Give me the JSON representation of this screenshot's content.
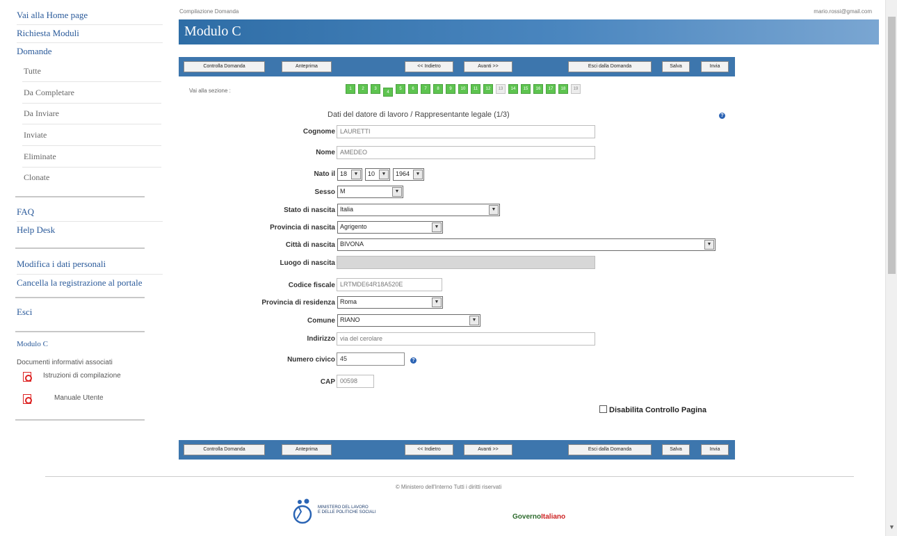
{
  "sidebar": {
    "home": "Vai alla Home page",
    "richiesta": "Richiesta Moduli",
    "domande": "Domande",
    "sub": [
      "Tutte",
      "Da Completare",
      "Da Inviare",
      "Inviate",
      "Eliminate",
      "Clonate"
    ],
    "faq": "FAQ",
    "help": "Help Desk",
    "modifica": "Modifica i dati personali",
    "cancella": "Cancella la registrazione al portale",
    "esci": "Esci",
    "modulo": "Modulo C",
    "docs_title": "Documenti informativi associati",
    "doc1": "Istruzioni di compilazione",
    "doc2": "Manuale Utente"
  },
  "header": {
    "breadcrumb": "Compilazione Domanda",
    "email": "mario.rossi@gmail.com",
    "title": "Modulo C"
  },
  "toolbar": {
    "controlla": "Controlla Domanda",
    "anteprima": "Anteprima",
    "indietro": "<< Indietro",
    "avanti": "Avanti >>",
    "esci": "Esci dalla Domanda",
    "salva": "Salva",
    "invia": "Invia"
  },
  "sections": {
    "label": "Vai alla sezione :",
    "items": [
      "1",
      "2",
      "3",
      "4",
      "5",
      "6",
      "7",
      "8",
      "9",
      "10",
      "11",
      "12",
      "13",
      "14",
      "15",
      "16",
      "17",
      "18",
      "19"
    ],
    "current": "4",
    "disabled": [
      "13",
      "19"
    ]
  },
  "form": {
    "title": "Dati del datore di lavoro / Rappresentante legale (1/3)",
    "cognome_label": "Cognome",
    "cognome": "LAURETTI",
    "nome_label": "Nome",
    "nome": "AMEDEO",
    "nato_label": "Nato il",
    "nato_giorno": "18",
    "nato_mese": "10",
    "nato_anno": "1964",
    "sesso_label": "Sesso",
    "sesso": "M",
    "stato_label": "Stato di nascita",
    "stato": "Italia",
    "provincia_nascita_label": "Provincia di nascita",
    "provincia_nascita": "Agrigento",
    "citta_label": "Città di nascita",
    "citta": "BIVONA",
    "luogo_label": "Luogo di nascita",
    "cf_label": "Codice fiscale",
    "cf": "LRTMDE64R18A520E",
    "provincia_res_label": "Provincia di residenza",
    "provincia_res": "Roma",
    "comune_label": "Comune",
    "comune": "RIANO",
    "indirizzo_label": "Indirizzo",
    "indirizzo": "via del cerolare",
    "civico_label": "Numero civico",
    "civico": "45",
    "cap_label": "CAP",
    "cap": "00598",
    "disable_label": "Disabilita Controllo Pagina"
  },
  "footer": {
    "copyright": "© Ministero dell'Interno Tutti i diritti riservati",
    "ministero_1": "MINISTERO DEL LAVORO",
    "ministero_2": "E DELLE POLITICHE SOCIALI",
    "governo_1": "Governo",
    "governo_2": "Italiano"
  }
}
